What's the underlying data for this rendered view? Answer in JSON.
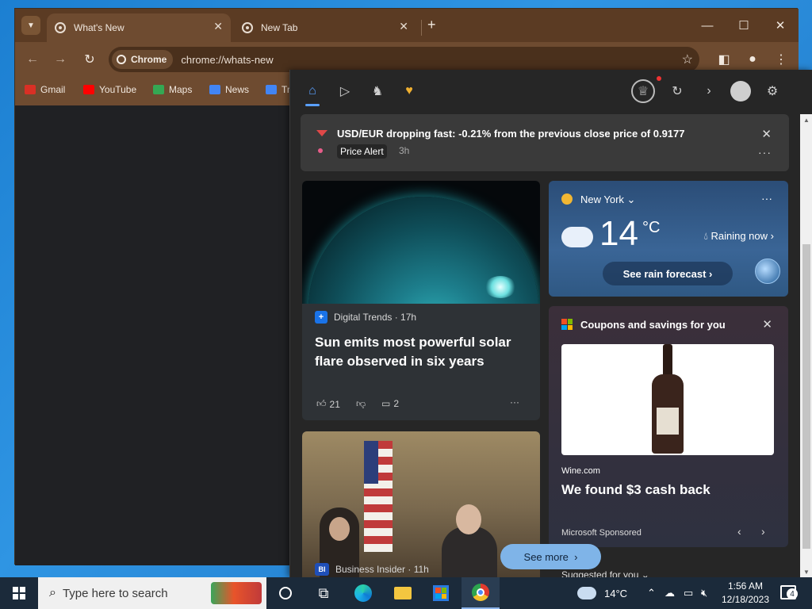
{
  "browser": {
    "tabs": [
      {
        "title": "What's New",
        "active": true
      },
      {
        "title": "New Tab",
        "active": false
      }
    ],
    "omnibox": {
      "chip": "Chrome",
      "url": "chrome://whats-new"
    },
    "bookmarks": [
      {
        "label": "Gmail",
        "color": "#d93025"
      },
      {
        "label": "YouTube",
        "color": "#ff0000"
      },
      {
        "label": "Maps",
        "color": "#34a853"
      },
      {
        "label": "News",
        "color": "#4285f4"
      },
      {
        "label": "Tr",
        "color": "#4285f4"
      }
    ]
  },
  "widgets": {
    "alert": {
      "title": "USD/EUR dropping fast: -0.21% from the previous close price of 0.9177",
      "badge": "Price Alert",
      "time": "3h"
    },
    "news1": {
      "source": "Digital Trends · 17h",
      "title": "Sun emits most powerful solar flare observed in six years",
      "likes": "21",
      "comments": "2"
    },
    "weather": {
      "location": "New York",
      "temp": "14",
      "unit": "°C",
      "condition": "Raining now",
      "button": "See rain forecast"
    },
    "coupons": {
      "title": "Coupons and savings for you",
      "source": "Wine.com",
      "headline": "We found $3 cash back",
      "sponsor": "Microsoft Sponsored"
    },
    "news2": {
      "source": "Business Insider · 11h",
      "source_icon": "BI"
    },
    "see_more": "See more",
    "suggested": "Suggested for you"
  },
  "taskbar": {
    "search_placeholder": "Type here to search",
    "weather": "14°C",
    "time": "1:56 AM",
    "date": "12/18/2023",
    "notification_count": "4"
  },
  "colors": {
    "accent": "#5aa0ff",
    "alert_red": "#e04848",
    "tab_strip": "#5b3b23",
    "panel_bg": "#262626"
  }
}
